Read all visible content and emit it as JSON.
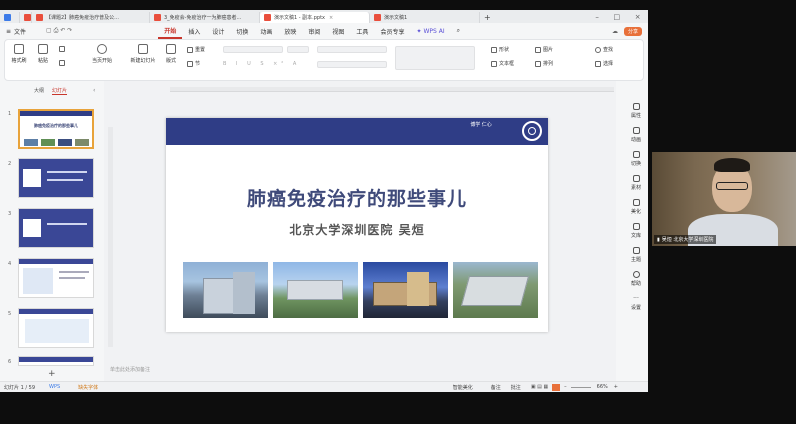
{
  "tabs": [
    {
      "label": "【课题2】肺癌免疫治疗普及公...",
      "color": "#e94e3c"
    },
    {
      "label": "3_免疫会-免疫治疗一为肺癌患者...",
      "color": "#e94e3c"
    },
    {
      "label": "演示文稿1 - 副本.pptx",
      "color": "#e94e3c"
    },
    {
      "label": "演示文稿1",
      "color": "#e94e3c"
    }
  ],
  "menubar": {
    "file": "文件",
    "items": [
      "开始",
      "插入",
      "设计",
      "切换",
      "动画",
      "放映",
      "审阅",
      "视图",
      "工具",
      "会员专享"
    ],
    "wps_ai": "WPS AI",
    "share": "分享"
  },
  "ribbon": {
    "format_painter": "格式刷",
    "paste": "粘贴",
    "play_from_current": "当页开始",
    "new_slide": "新建幻灯片",
    "layout": "版式",
    "section": "节",
    "reset": "重置",
    "shape": "形状",
    "textbox": "文本框",
    "image": "图片",
    "arrange": "排列",
    "find": "查找",
    "select": "选择"
  },
  "left_panel": {
    "outline_tab": "大纲",
    "slides_tab": "幻灯片",
    "thumb_titles": [
      "肺癌免疫治疗的那些事儿",
      "",
      "",
      "",
      "",
      ""
    ],
    "add": "+"
  },
  "slide": {
    "title": "肺癌免疫治疗的那些事儿",
    "subtitle": "北京大学深圳医院  吴烜",
    "header_brand": "博学 仁心"
  },
  "notes_placeholder": "单击此处添加备注",
  "right_bar": [
    "属性",
    "动画",
    "切换",
    "素材",
    "美化",
    "文库",
    "主题",
    "帮助",
    "设置"
  ],
  "statusbar": {
    "slide_count": "幻灯片 1 / 59",
    "wps": "WPS",
    "font_missing": "缺失字体",
    "smart_beautify": "智能美化",
    "notes": "备注",
    "comments": "批注",
    "zoom": "66%"
  },
  "webcam": {
    "label": "吴烜  北京大学深圳医院"
  },
  "colors": {
    "accent": "#c8362c",
    "slide_header": "#2f3d86",
    "title": "#3f4a7a"
  }
}
